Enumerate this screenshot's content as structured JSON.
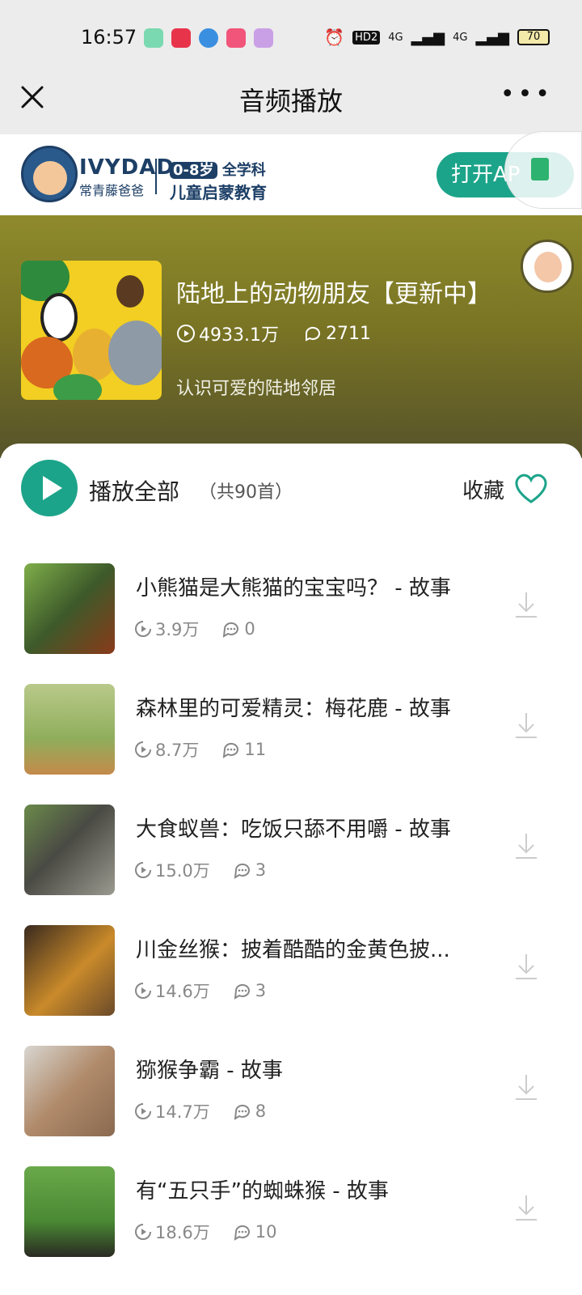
{
  "status_bar": {
    "time": "16:57",
    "network_badge": "HD2",
    "signal_1": "4G",
    "signal_2": "4G",
    "battery": "70"
  },
  "title_bar": {
    "title": "音频播放"
  },
  "banner": {
    "brand_en": "IVYDAD",
    "brand_cn": "常青藤爸爸",
    "age_range": "0-8岁",
    "subject": "全学科",
    "tagline": "儿童启蒙教育",
    "open_app_label": "打开AP"
  },
  "album": {
    "title": "陆地上的动物朋友【更新中】",
    "plays": "4933.1万",
    "comments": "2711",
    "description": "认识可爱的陆地邻居"
  },
  "list_header": {
    "play_all_label": "播放全部",
    "count_label": "（共90首）",
    "favorite_label": "收藏"
  },
  "tracks": [
    {
      "title": "小熊猫是大熊猫的宝宝吗？  - 故事",
      "plays": "3.9万",
      "comments": "0"
    },
    {
      "title": "森林里的可爱精灵：梅花鹿  - 故事",
      "plays": "8.7万",
      "comments": "11"
    },
    {
      "title": "大食蚁兽：吃饭只舔不用嚼  - 故事",
      "plays": "15.0万",
      "comments": "3"
    },
    {
      "title": "川金丝猴：披着酷酷的金黄色披...",
      "plays": "14.6万",
      "comments": "3"
    },
    {
      "title": "猕猴争霸  - 故事",
      "plays": "14.7万",
      "comments": "8"
    },
    {
      "title": "有“五只手”的蜘蛛猴  - 故事",
      "plays": "18.6万",
      "comments": "10"
    }
  ],
  "colors": {
    "accent": "#1ca48a",
    "brand_navy": "#1d3f66",
    "album_bg": "#7a7524"
  }
}
